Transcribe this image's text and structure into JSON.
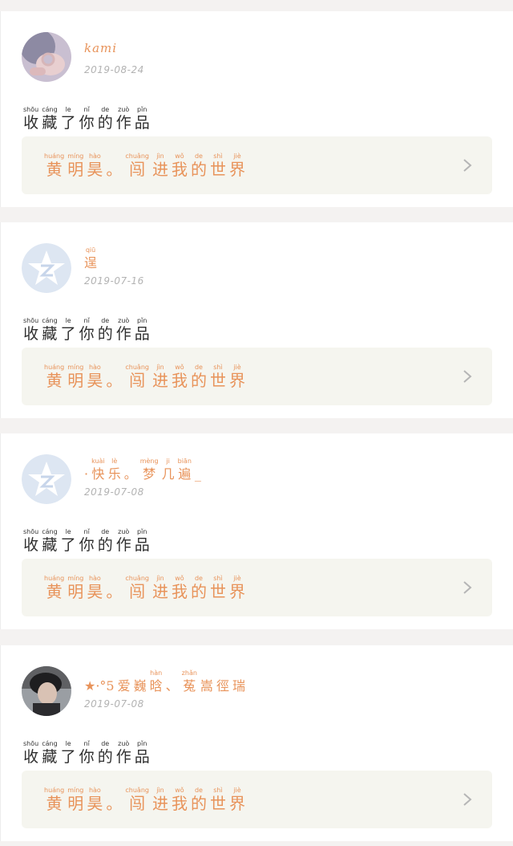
{
  "feed": [
    {
      "user_name": "kami",
      "date": "2019-08-24",
      "avatar": "photo-hand-avatar",
      "action": [
        {
          "py": "shōu",
          "hz": "收"
        },
        {
          "py": "cáng",
          "hz": "藏"
        },
        {
          "py": "le",
          "hz": "了"
        },
        {
          "py": "nǐ",
          "hz": "你"
        },
        {
          "py": "de",
          "hz": "的"
        },
        {
          "py": "zuò",
          "hz": "作"
        },
        {
          "py": "pǐn",
          "hz": "品"
        }
      ],
      "work_title": [
        {
          "py": "huáng",
          "hz": "黄"
        },
        {
          "py": "míng",
          "hz": "明"
        },
        {
          "py": "hào",
          "hz": "昊"
        },
        {
          "py": "",
          "hz": "。"
        },
        {
          "py": "chuǎng",
          "hz": "闯"
        },
        {
          "py": "jìn",
          "hz": "进"
        },
        {
          "py": "wǒ",
          "hz": "我"
        },
        {
          "py": "de",
          "hz": "的"
        },
        {
          "py": "shì",
          "hz": "世"
        },
        {
          "py": "jiè",
          "hz": "界"
        }
      ]
    },
    {
      "user_name_ruby": [
        {
          "py": "qiū",
          "hz": "逞"
        }
      ],
      "date": "2019-07-16",
      "avatar": "qzone-star-avatar",
      "action": [
        {
          "py": "shōu",
          "hz": "收"
        },
        {
          "py": "cáng",
          "hz": "藏"
        },
        {
          "py": "le",
          "hz": "了"
        },
        {
          "py": "nǐ",
          "hz": "你"
        },
        {
          "py": "de",
          "hz": "的"
        },
        {
          "py": "zuò",
          "hz": "作"
        },
        {
          "py": "pǐn",
          "hz": "品"
        }
      ],
      "work_title": [
        {
          "py": "huáng",
          "hz": "黄"
        },
        {
          "py": "míng",
          "hz": "明"
        },
        {
          "py": "hào",
          "hz": "昊"
        },
        {
          "py": "",
          "hz": "。"
        },
        {
          "py": "chuǎng",
          "hz": "闯"
        },
        {
          "py": "jìn",
          "hz": "进"
        },
        {
          "py": "wǒ",
          "hz": "我"
        },
        {
          "py": "de",
          "hz": "的"
        },
        {
          "py": "shì",
          "hz": "世"
        },
        {
          "py": "jiè",
          "hz": "界"
        }
      ]
    },
    {
      "user_name_ruby": [
        {
          "py": "",
          "hz": "·"
        },
        {
          "py": "kuài",
          "hz": "快"
        },
        {
          "py": "lè",
          "hz": "乐"
        },
        {
          "py": "",
          "hz": "。"
        },
        {
          "py": "mèng",
          "hz": "梦"
        },
        {
          "py": "ji",
          "hz": "几"
        },
        {
          "py": "biān",
          "hz": "遍"
        },
        {
          "py": "",
          "hz": "_"
        }
      ],
      "date": "2019-07-08",
      "avatar": "qzone-star-avatar",
      "action": [
        {
          "py": "shōu",
          "hz": "收"
        },
        {
          "py": "cáng",
          "hz": "藏"
        },
        {
          "py": "le",
          "hz": "了"
        },
        {
          "py": "nǐ",
          "hz": "你"
        },
        {
          "py": "de",
          "hz": "的"
        },
        {
          "py": "zuò",
          "hz": "作"
        },
        {
          "py": "pǐn",
          "hz": "品"
        }
      ],
      "work_title": [
        {
          "py": "huáng",
          "hz": "黄"
        },
        {
          "py": "míng",
          "hz": "明"
        },
        {
          "py": "hào",
          "hz": "昊"
        },
        {
          "py": "",
          "hz": "。"
        },
        {
          "py": "chuǎng",
          "hz": "闯"
        },
        {
          "py": "jìn",
          "hz": "进"
        },
        {
          "py": "wǒ",
          "hz": "我"
        },
        {
          "py": "de",
          "hz": "的"
        },
        {
          "py": "shì",
          "hz": "世"
        },
        {
          "py": "jiè",
          "hz": "界"
        }
      ]
    },
    {
      "user_name_ruby": [
        {
          "py": "",
          "hz": "★·°5"
        },
        {
          "py": "",
          "hz": "爱"
        },
        {
          "py": "",
          "hz": "巍"
        },
        {
          "py": "hàn",
          "hz": "晗"
        },
        {
          "py": "",
          "hz": "、"
        },
        {
          "py": "zhǎn",
          "hz": "菟"
        },
        {
          "py": "",
          "hz": "嵩"
        },
        {
          "py": "",
          "hz": "徑"
        },
        {
          "py": "",
          "hz": "瑞"
        }
      ],
      "date": "2019-07-08",
      "avatar": "photo-person-avatar",
      "action": [
        {
          "py": "shōu",
          "hz": "收"
        },
        {
          "py": "cáng",
          "hz": "藏"
        },
        {
          "py": "le",
          "hz": "了"
        },
        {
          "py": "nǐ",
          "hz": "你"
        },
        {
          "py": "de",
          "hz": "的"
        },
        {
          "py": "zuò",
          "hz": "作"
        },
        {
          "py": "pǐn",
          "hz": "品"
        }
      ],
      "work_title": [
        {
          "py": "huáng",
          "hz": "黄"
        },
        {
          "py": "míng",
          "hz": "明"
        },
        {
          "py": "hào",
          "hz": "昊"
        },
        {
          "py": "",
          "hz": "。"
        },
        {
          "py": "chuǎng",
          "hz": "闯"
        },
        {
          "py": "jìn",
          "hz": "进"
        },
        {
          "py": "wǒ",
          "hz": "我"
        },
        {
          "py": "de",
          "hz": "的"
        },
        {
          "py": "shì",
          "hz": "世"
        },
        {
          "py": "jiè",
          "hz": "界"
        }
      ]
    }
  ],
  "colors": {
    "accent": "#e8935a",
    "card_bg": "#ffffff",
    "page_bg": "#f4f2f1",
    "link_bg": "#f5f5ef",
    "date": "#b3b3b3"
  }
}
